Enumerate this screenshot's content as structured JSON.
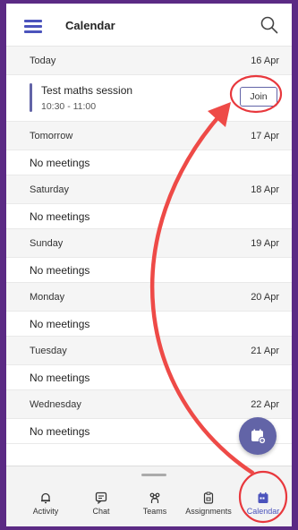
{
  "header": {
    "title": "Calendar",
    "menu_icon": "hamburger-menu-icon",
    "search_icon": "search-icon"
  },
  "agenda": [
    {
      "day": "Today",
      "date": "16 Apr",
      "meeting": {
        "title": "Test maths session",
        "time": "10:30 - 11:00",
        "join_label": "Join"
      }
    },
    {
      "day": "Tomorrow",
      "date": "17 Apr",
      "empty_text": "No meetings"
    },
    {
      "day": "Saturday",
      "date": "18 Apr",
      "empty_text": "No meetings"
    },
    {
      "day": "Sunday",
      "date": "19 Apr",
      "empty_text": "No meetings"
    },
    {
      "day": "Monday",
      "date": "20 Apr",
      "empty_text": "No meetings"
    },
    {
      "day": "Tuesday",
      "date": "21 Apr",
      "empty_text": "No meetings"
    },
    {
      "day": "Wednesday",
      "date": "22 Apr",
      "empty_text": "No meetings"
    }
  ],
  "fab": {
    "icon": "new-meeting-calendar-icon"
  },
  "nav": [
    {
      "label": "Activity",
      "icon": "bell-icon"
    },
    {
      "label": "Chat",
      "icon": "chat-icon"
    },
    {
      "label": "Teams",
      "icon": "teams-icon"
    },
    {
      "label": "Assignments",
      "icon": "assignments-icon"
    },
    {
      "label": "Calendar",
      "icon": "calendar-icon",
      "active": true
    }
  ],
  "colors": {
    "accent": "#6264a7",
    "frame": "#5b2a84",
    "annotation": "#e8383d"
  }
}
